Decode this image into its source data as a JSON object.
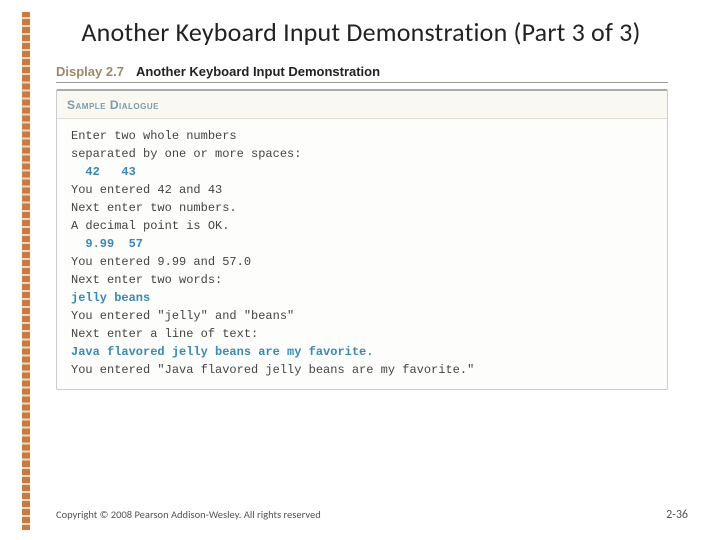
{
  "title": "Another Keyboard Input Demonstration (Part 3 of 3)",
  "display": {
    "label": "Display 2.7",
    "title": "Another Keyboard Input Demonstration"
  },
  "sample": {
    "header": "Sample Dialogue",
    "lines": [
      {
        "text": "Enter two whole numbers",
        "user": false
      },
      {
        "text": "separated by one or more spaces:",
        "user": false
      },
      {
        "text": "  42   43",
        "user": true
      },
      {
        "text": "You entered 42 and 43",
        "user": false
      },
      {
        "text": "Next enter two numbers.",
        "user": false
      },
      {
        "text": "A decimal point is OK.",
        "user": false
      },
      {
        "text": "  9.99  57",
        "user": true
      },
      {
        "text": "You entered 9.99 and 57.0",
        "user": false
      },
      {
        "text": "Next enter two words:",
        "user": false
      },
      {
        "text": "jelly beans",
        "user": true
      },
      {
        "text": "You entered \"jelly\" and \"beans\"",
        "user": false
      },
      {
        "text": "Next enter a line of text:",
        "user": false
      },
      {
        "text": "Java flavored jelly beans are my favorite.",
        "user": true
      },
      {
        "text": "You entered \"Java flavored jelly beans are my favorite.\"",
        "user": false
      }
    ]
  },
  "footer": {
    "copyright": "Copyright © 2008 Pearson Addison-Wesley. All rights reserved",
    "page": "2-36"
  }
}
